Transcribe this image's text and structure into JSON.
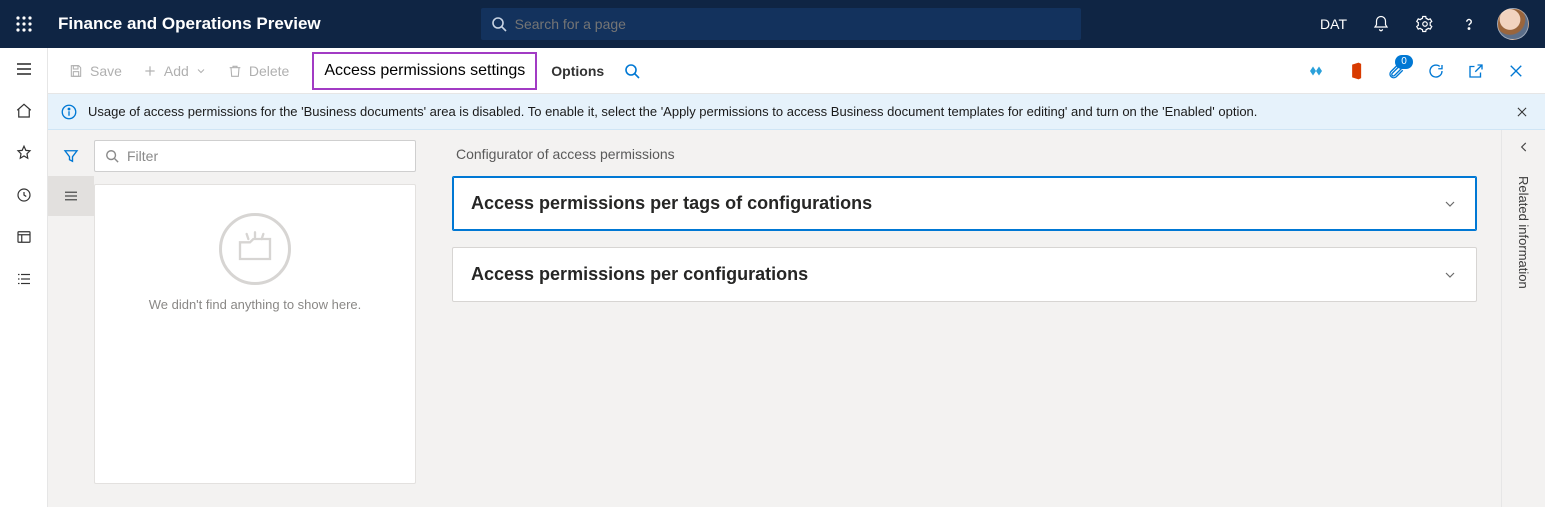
{
  "navbar": {
    "app_title": "Finance and Operations Preview",
    "search_placeholder": "Search for a page",
    "company": "DAT"
  },
  "commands": {
    "save": "Save",
    "add": "Add",
    "delete": "Delete",
    "access_settings": "Access permissions settings",
    "options": "Options",
    "attachments_count": "0"
  },
  "banner": {
    "message": "Usage of access permissions for the 'Business documents' area is disabled. To enable it, select the 'Apply permissions to access Business document templates for editing' and turn on the 'Enabled' option."
  },
  "list": {
    "filter_placeholder": "Filter",
    "empty_message": "We didn't find anything to show here."
  },
  "config": {
    "title": "Configurator of access permissions",
    "panel_tags": "Access permissions per tags of configurations",
    "panel_cfg": "Access permissions per configurations"
  },
  "rightrail": {
    "label": "Related information"
  }
}
